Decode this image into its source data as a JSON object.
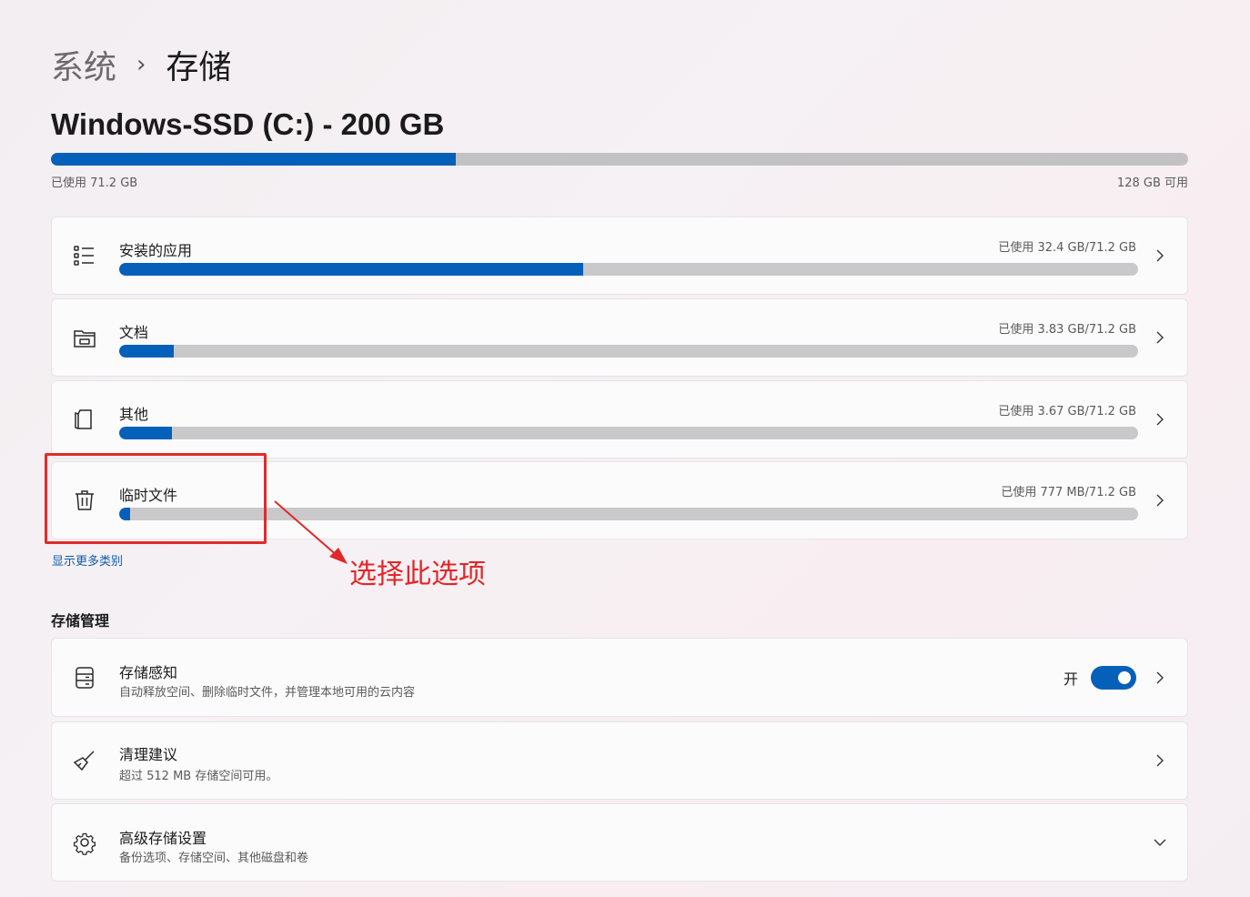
{
  "breadcrumb": {
    "parent": "系统",
    "separator": "›",
    "current": "存储"
  },
  "drive": {
    "title": "Windows-SSD (C:) - 200 GB",
    "used_label": "已使用 71.2 GB",
    "free_label": "128 GB 可用",
    "used_fraction": 0.356
  },
  "categories": [
    {
      "name": "安装的应用",
      "usage": "已使用 32.4 GB/71.2 GB",
      "fraction": 0.455,
      "icon": "app-list-icon"
    },
    {
      "name": "文档",
      "usage": "已使用 3.83 GB/71.2 GB",
      "fraction": 0.054,
      "icon": "folder-icon"
    },
    {
      "name": "其他",
      "usage": "已使用 3.67 GB/71.2 GB",
      "fraction": 0.052,
      "icon": "other-file-icon"
    },
    {
      "name": "临时文件",
      "usage": "已使用 777 MB/71.2 GB",
      "fraction": 0.011,
      "icon": "trash-icon"
    }
  ],
  "more_link": "显示更多类别",
  "management": {
    "title": "存储管理",
    "items": [
      {
        "name": "存储感知",
        "desc": "自动释放空间、删除临时文件，并管理本地可用的云内容",
        "toggle_label": "开",
        "toggle_on": true,
        "icon": "storage-sense-icon"
      },
      {
        "name": "清理建议",
        "desc": "超过 512 MB 存储空间可用。",
        "icon": "broom-icon"
      },
      {
        "name": "高级存储设置",
        "desc": "备份选项、存储空间、其他磁盘和卷",
        "icon": "gear-icon"
      }
    ]
  },
  "annotation": {
    "text": "选择此选项",
    "color": "#e3262a"
  },
  "colors": {
    "accent": "#0560b9",
    "bar_track": "#c9c9cb"
  }
}
